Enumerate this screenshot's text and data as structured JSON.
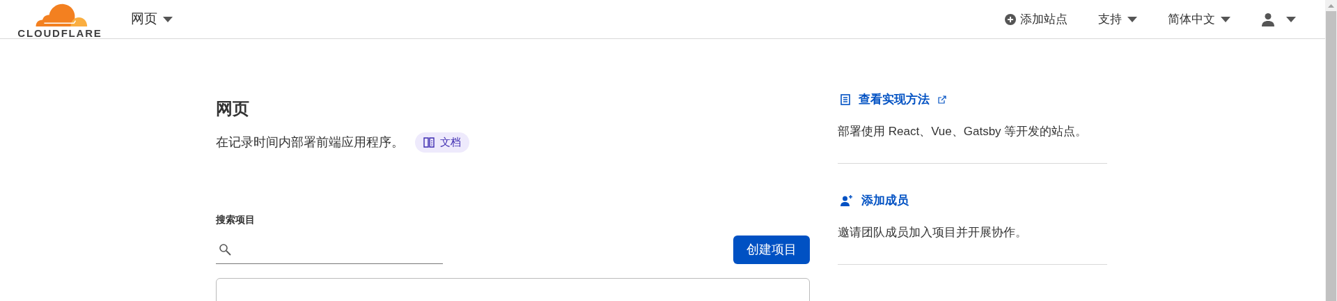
{
  "header": {
    "logo": "CLOUDFLARE",
    "nav": {
      "label": "网页"
    },
    "actions": [
      {
        "kind": "add",
        "label": "添加站点"
      },
      {
        "kind": "menu",
        "label": "支持"
      },
      {
        "kind": "menu",
        "label": "简体中文"
      },
      {
        "kind": "user"
      }
    ]
  },
  "page": {
    "title": "网页",
    "description": "在记录时间内部署前端应用程序。",
    "docs_badge": "文档"
  },
  "search": {
    "label": "搜索项目"
  },
  "create_button": "创建项目",
  "side_items": [
    {
      "kind": "docs",
      "title": "查看实现方法",
      "external": true,
      "description": "部署使用 React、Vue、Gatsby 等开发的站点。"
    },
    {
      "kind": "member",
      "title": "添加成员",
      "external": false,
      "description": "邀请团队成员加入项目并开展协作。"
    }
  ]
}
